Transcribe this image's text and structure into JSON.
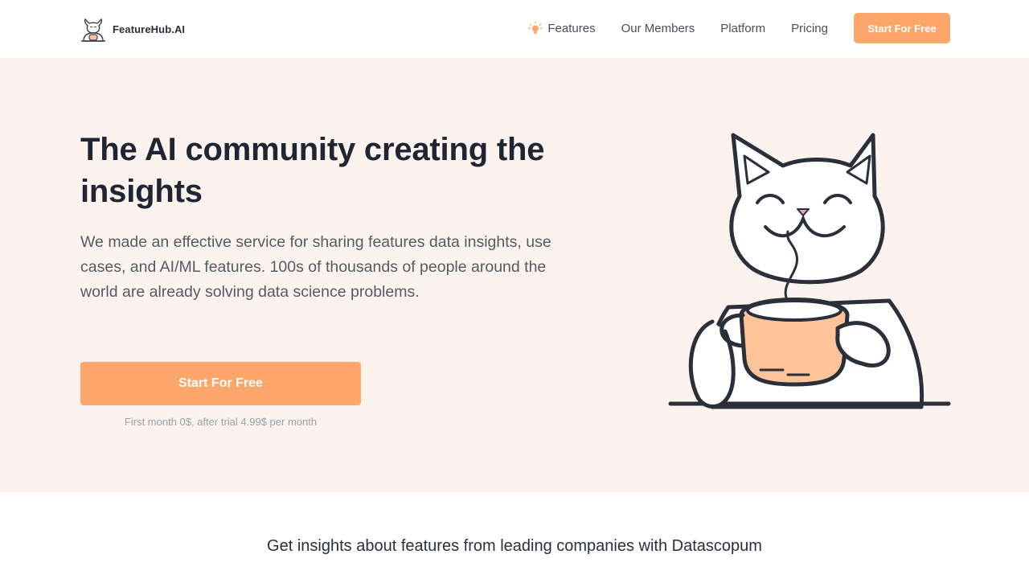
{
  "header": {
    "brand": {
      "name": "FeatureHub.AI",
      "logo_icon": "cat-mascot-logo-icon"
    },
    "nav": [
      {
        "label": "Features",
        "icon": "lightbulb-icon"
      },
      {
        "label": "Our Members"
      },
      {
        "label": "Platform"
      },
      {
        "label": "Pricing"
      }
    ],
    "cta_label": "Start For Free"
  },
  "hero": {
    "title": "The AI community creating the insights",
    "description": "We made an effective service for sharing features data insights, use cases, and AI/ML features. 100s of thousands of people around the world are already solving data science problems.",
    "cta_label": "Start For Free",
    "note": "First month 0$, after trial 4.99$ per month",
    "illustration": "cat-drinking-coffee-illustration"
  },
  "insights": {
    "heading": "Get insights about features  from leading companies with Datascopum"
  },
  "colors": {
    "accent": "#fda66b",
    "hero_background": "#fcf3ef",
    "text_dark": "#1f2533",
    "text_muted": "#545a67",
    "note_text": "#9aa0ab"
  }
}
